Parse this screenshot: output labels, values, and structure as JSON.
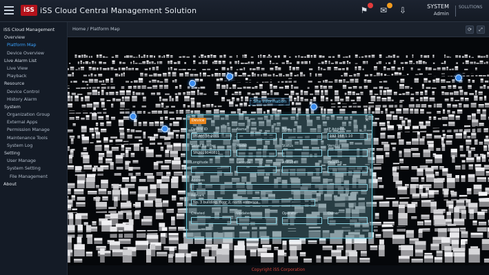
{
  "header": {
    "logo_text": "iSS",
    "title": "iSS Cloud Central Management Solution",
    "icons": [
      "alarm-icon",
      "message-icon",
      "download-icon"
    ],
    "user_name": "SYSTEM",
    "user_sub": "Admin",
    "brand_mark": "SOLUTIONS"
  },
  "sidebar": {
    "items": [
      {
        "label": "iSS Cloud Management",
        "level": "module"
      },
      {
        "label": "Overview",
        "level": "lv0"
      },
      {
        "label": "Platform Map",
        "level": "lv1",
        "active": true
      },
      {
        "label": "Device Overview",
        "level": "lv1"
      },
      {
        "label": "Live Alarm List",
        "level": "lv0"
      },
      {
        "label": "Live View",
        "level": "lv1"
      },
      {
        "label": "Playback",
        "level": "lv1"
      },
      {
        "label": "Resource",
        "level": "lv0"
      },
      {
        "label": "Device Control",
        "level": "lv1"
      },
      {
        "label": "History Alarm",
        "level": "lv1"
      },
      {
        "label": "System",
        "level": "lv0"
      },
      {
        "label": "Organization Group",
        "level": "lv1"
      },
      {
        "label": "External Apps",
        "level": "lv1"
      },
      {
        "label": "Permission Manage",
        "level": "lv1"
      },
      {
        "label": "Maintenance Tools",
        "level": "lv1"
      },
      {
        "label": "System Log",
        "level": "lv1"
      },
      {
        "label": "Setting",
        "level": "lv0"
      },
      {
        "label": "User Manage",
        "level": "lv1"
      },
      {
        "label": "System Setting",
        "level": "lv1"
      },
      {
        "label": "File Management",
        "level": "lv2"
      },
      {
        "label": "About",
        "level": "module"
      }
    ]
  },
  "main": {
    "breadcrumb": "Home / Platform Map",
    "btn_refresh": "⟳",
    "btn_full": "⤢",
    "map_label": "Site Information",
    "panel": {
      "head": "Device",
      "close": "×",
      "rows": [
        {
          "label": "Device ID",
          "value": "IPCAM-3F-2001"
        },
        {
          "label": "Name",
          "value": ""
        },
        {
          "label": "Type",
          "value": ""
        },
        {
          "label": "IP Address",
          "value": "192.168.1.10"
        }
      ],
      "rows2": [
        {
          "label": "Serial Number",
          "value": "SN2019040811"
        },
        {
          "label": "Model",
          "value": ""
        },
        {
          "label": "Status",
          "value": ""
        },
        {
          "label": "Version",
          "value": ""
        }
      ],
      "rows3": [
        {
          "label": "Longitude",
          "value": ""
        },
        {
          "label": "Latitude",
          "value": ""
        },
        {
          "label": "Altitude",
          "value": ""
        },
        {
          "label": "Heading",
          "value": ""
        }
      ],
      "address_label": "Address",
      "remark_label": "Remark",
      "remark_value": "No. 3 building, floor 2, north entrance",
      "rows4": [
        {
          "label": "Created",
          "value": ""
        },
        {
          "label": "Updated",
          "value": ""
        },
        {
          "label": "Operator",
          "value": ""
        },
        {
          "label": "Owner",
          "value": ""
        }
      ]
    }
  },
  "footer": {
    "text": "Copyright iSS Corporation"
  },
  "colors": {
    "accent": "#3aa3ff",
    "alert": "#e23b3b",
    "panel_border": "#5fc4d8",
    "header_tag": "#e8841c"
  }
}
